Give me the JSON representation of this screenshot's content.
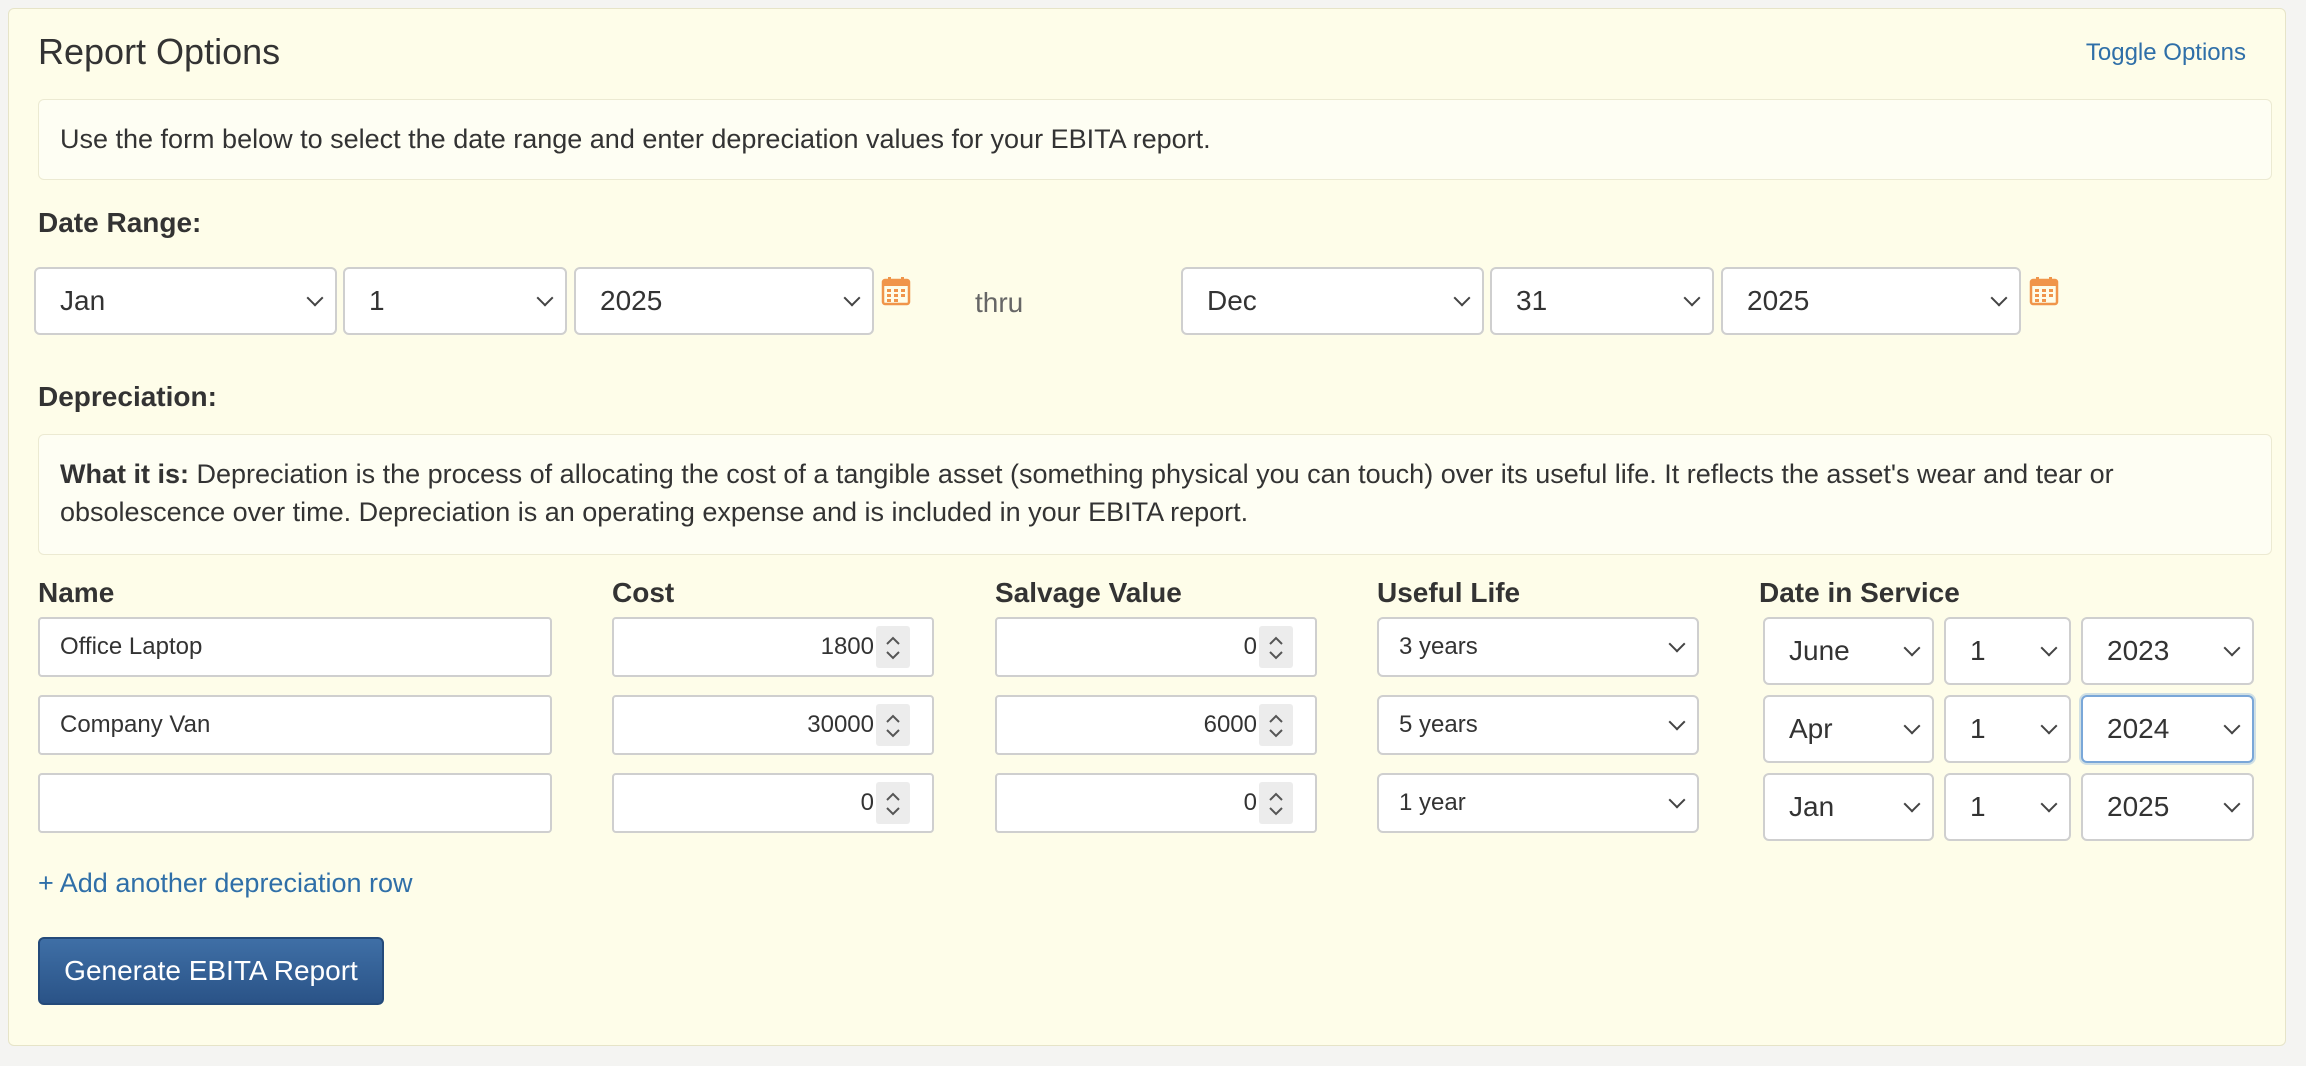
{
  "header": {
    "title": "Report Options",
    "toggle_label": "Toggle Options"
  },
  "intro_text": "Use the form below to select the date range and enter depreciation values for your EBITA report.",
  "date_range": {
    "label": "Date Range:",
    "start": {
      "month": "Jan",
      "day": "1",
      "year": "2025"
    },
    "separator": "thru",
    "end": {
      "month": "Dec",
      "day": "31",
      "year": "2025"
    }
  },
  "depreciation": {
    "label": "Depreciation:",
    "info_bold": "What it is:",
    "info_text": " Depreciation is the process of allocating the cost of a tangible asset (something physical you can touch) over its useful life. It reflects the asset's wear and tear or obsolescence over time. Depreciation is an operating expense and is included in your EBITA report.",
    "columns": {
      "name": "Name",
      "cost": "Cost",
      "salvage": "Salvage Value",
      "life": "Useful Life",
      "date": "Date in Service"
    },
    "rows": [
      {
        "name": "Office Laptop",
        "cost": "1800",
        "salvage": "0",
        "life": "3 years",
        "month": "June",
        "day": "1",
        "year": "2023"
      },
      {
        "name": "Company Van",
        "cost": "30000",
        "salvage": "6000",
        "life": "5 years",
        "month": "Apr",
        "day": "1",
        "year": "2024"
      },
      {
        "name": "",
        "cost": "0",
        "salvage": "0",
        "life": "1 year",
        "month": "Jan",
        "day": "1",
        "year": "2025"
      }
    ],
    "add_row_label": "+ Add another depreciation row"
  },
  "submit_label": "Generate EBITA Report",
  "colors": {
    "panel_bg": "#fefde9",
    "link": "#2f6fa8",
    "calendar_icon": "#f0954a",
    "button": "#2f5d94"
  },
  "icons": {
    "calendar": "calendar-icon",
    "dropdown": "chevron-down-icon",
    "spinner": "spinner-icon"
  }
}
